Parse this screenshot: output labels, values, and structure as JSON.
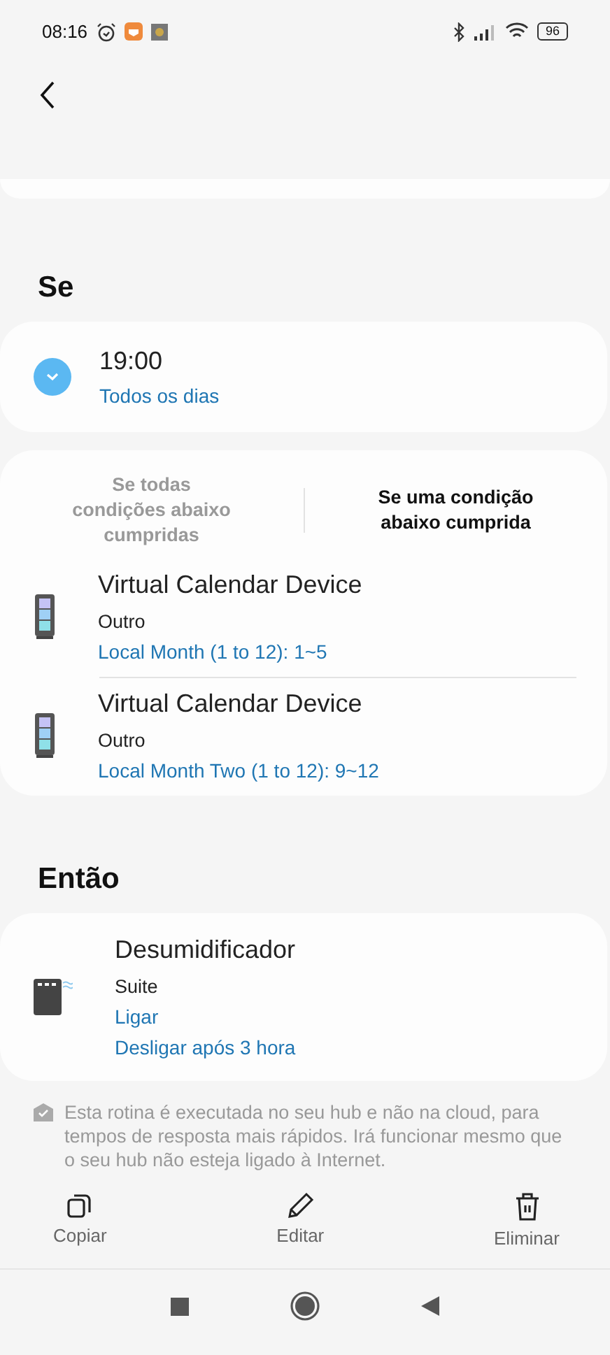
{
  "status_bar": {
    "time": "08:16",
    "battery": "96"
  },
  "if_section": {
    "title": "Se",
    "schedule": {
      "time": "19:00",
      "repeat": "Todos os dias"
    },
    "match_options": [
      {
        "label": "Se todas condições abaixo cumpridas",
        "selected": false
      },
      {
        "label": "Se uma condição abaixo cumprida",
        "selected": true
      }
    ],
    "conditions": [
      {
        "name": "Virtual Calendar Device",
        "room": "Outro",
        "detail": "Local Month (1 to 12): 1~5"
      },
      {
        "name": "Virtual Calendar Device",
        "room": "Outro",
        "detail": "Local Month Two (1 to 12): 9~12"
      }
    ]
  },
  "then_section": {
    "title": "Então",
    "actions": [
      {
        "name": "Desumidificador",
        "room": "Suite",
        "details": [
          "Ligar",
          "Desligar após 3 hora"
        ]
      }
    ]
  },
  "note": "Esta rotina é executada no seu hub e não na cloud, para tempos de resposta mais rápidos. Irá funcionar mesmo que o seu hub não esteja ligado à Internet.",
  "bottom_actions": [
    {
      "kind": "copy",
      "label": "Copiar"
    },
    {
      "kind": "edit",
      "label": "Editar"
    },
    {
      "kind": "delete",
      "label": "Eliminar"
    }
  ]
}
